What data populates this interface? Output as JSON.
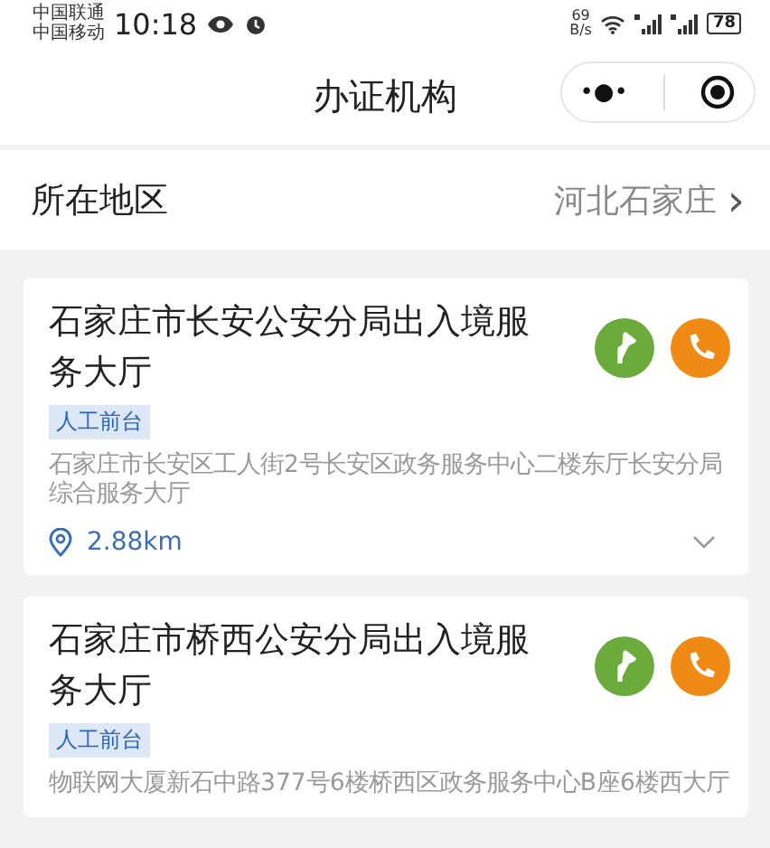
{
  "status_bar": {
    "carriers": [
      "中国联通",
      "中国移动"
    ],
    "time": "10:18",
    "speed": "69",
    "speed_unit": "B/s",
    "battery": "78"
  },
  "header": {
    "title": "办证机构",
    "menu_button": "•●•"
  },
  "region": {
    "label": "所在地区",
    "value": "河北石家庄",
    "chevron": "›"
  },
  "offices": [
    {
      "name": "石家庄市长安公安分局出入境服务大厅",
      "tag": "人工前台",
      "address": "石家庄市长安区工人街2号长安区政务服务中心二楼东厅长安分局综合服务大厅",
      "distance": "2.88km",
      "expanded": false
    },
    {
      "name": "石家庄市桥西公安分局出入境服务大厅",
      "tag": "人工前台",
      "address": "物联网大厦新石中路377号6楼桥西区政务服务中心B座6楼西大厅"
    }
  ]
}
